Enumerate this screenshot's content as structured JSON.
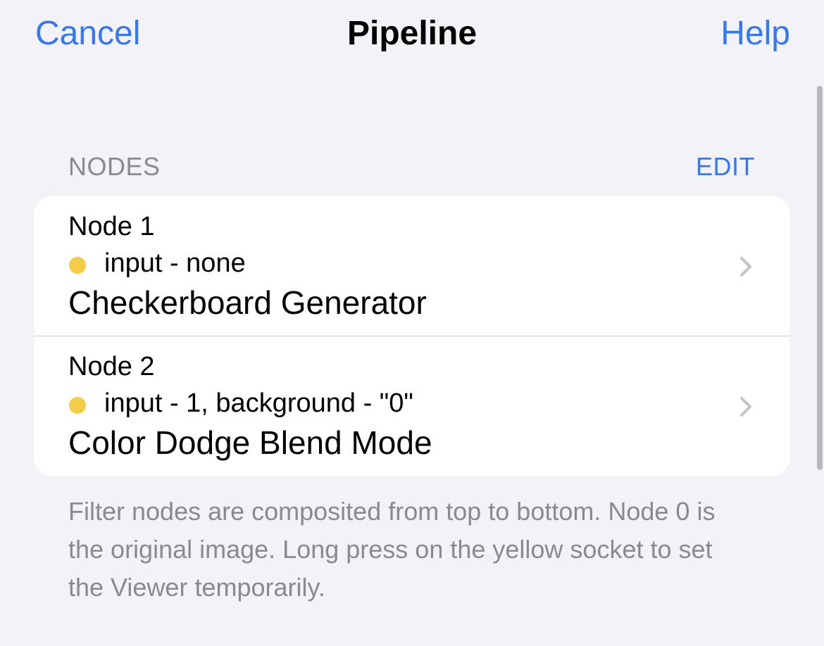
{
  "nav": {
    "cancel_label": "Cancel",
    "title": "Pipeline",
    "help_label": "Help"
  },
  "section": {
    "header": "NODES",
    "edit_label": "EDIT"
  },
  "nodes": [
    {
      "title": "Node 1",
      "inputs": "input - none",
      "filter": "Checkerboard Generator"
    },
    {
      "title": "Node 2",
      "inputs": "input - 1, background - \"0\"",
      "filter": "Color Dodge Blend Mode"
    }
  ],
  "footer": "Filter nodes are composited from top to bottom. Node 0 is the original image. Long press on the yellow socket to set the Viewer temporarily.",
  "colors": {
    "accent": "#3478f6",
    "socket": "#f5cc45",
    "background": "#f2f2f7",
    "secondary_text": "#8a8a8e"
  },
  "icons": {
    "row_disclosure": "chevron-right-icon",
    "socket": "yellow-socket-icon"
  }
}
